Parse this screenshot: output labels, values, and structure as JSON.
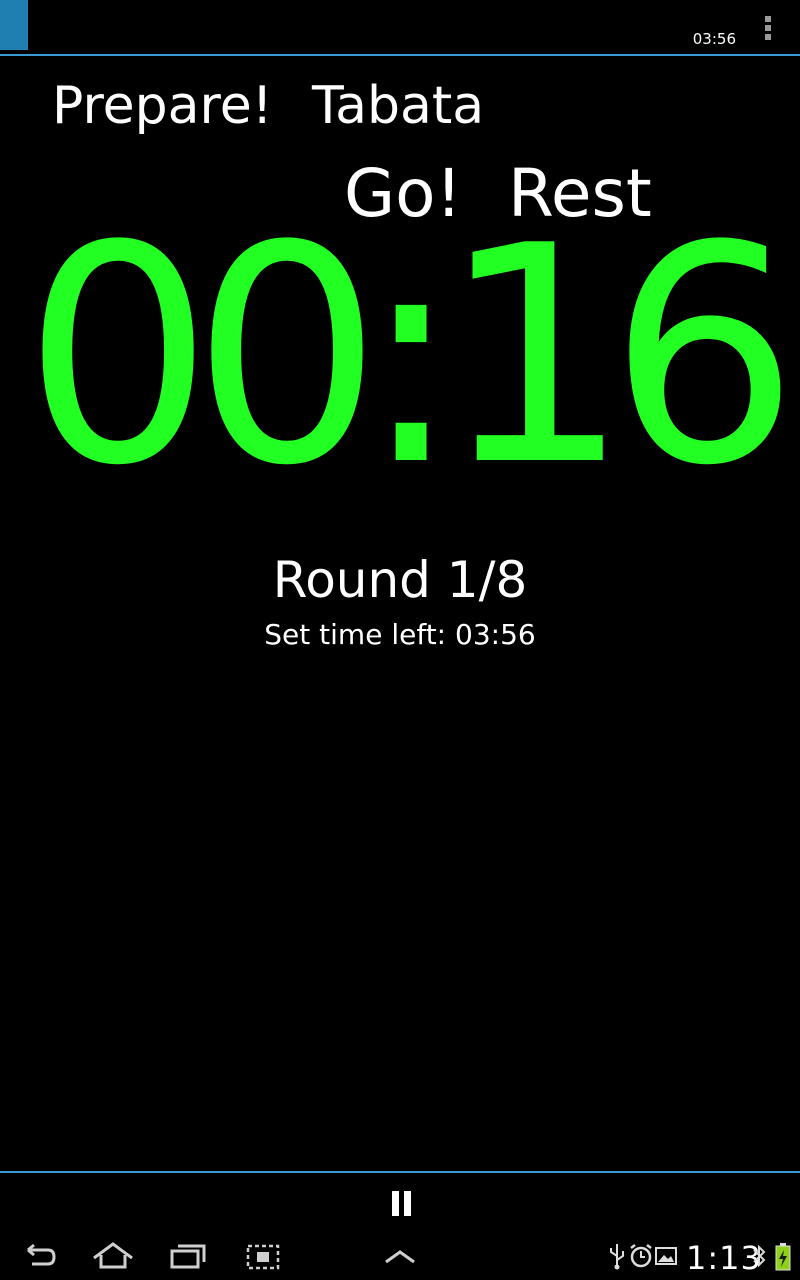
{
  "action_bar": {
    "time_left": "03:56",
    "overflow_icon": "overflow-menu-icon",
    "accent_color": "#3a9ad6"
  },
  "phases": {
    "prepare": "Prepare!",
    "program": "Tabata",
    "go": "Go!",
    "rest": "Rest"
  },
  "timer": {
    "display": "00:16",
    "color": "#22ff22"
  },
  "round": {
    "label": "Round 1/8"
  },
  "set_time": {
    "label": "Set time left: 03:56"
  },
  "controls": {
    "pause_icon": "pause-icon"
  },
  "system_bar": {
    "clock": "1:13",
    "nav_icons": [
      "back-icon",
      "home-icon",
      "recent-apps-icon",
      "screenshot-icon",
      "menu-up-icon"
    ],
    "status_icons": [
      "usb-icon",
      "alarm-icon",
      "gallery-icon",
      "bluetooth-icon",
      "battery-icon"
    ]
  }
}
